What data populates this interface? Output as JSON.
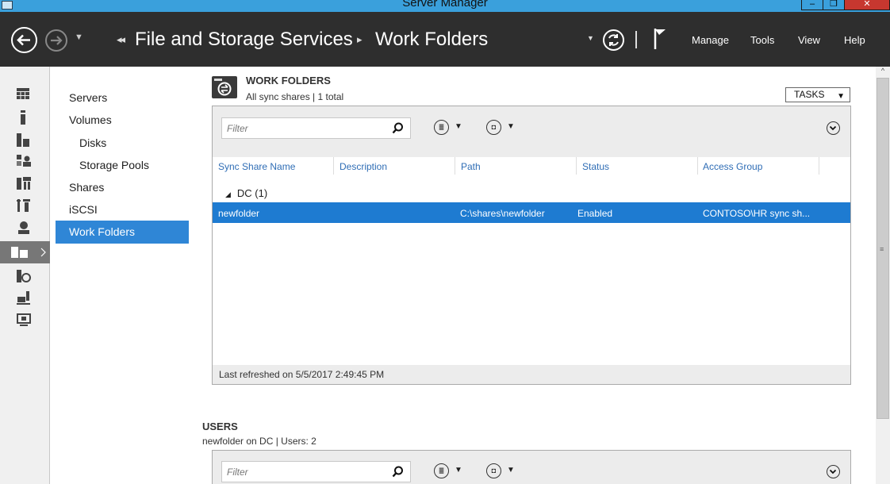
{
  "window": {
    "title": "Server Manager",
    "minimize": "‒",
    "maximize": "❐",
    "close": "✕"
  },
  "navbar": {
    "breadcrumb_prefix": "◂◂",
    "breadcrumb_1": "File and Storage Services",
    "breadcrumb_sep": "▸",
    "breadcrumb_2": "Work Folders",
    "dropdown_caret": "▼",
    "menus": [
      "Manage",
      "Tools",
      "View",
      "Help"
    ]
  },
  "rail_icons": [
    "dashboard-icon",
    "local-server-icon",
    "all-servers-icon",
    "ad-ds-icon",
    "ad-lds-icon",
    "dhcp-icon",
    "dns-icon",
    "file-storage-icon",
    "iis-icon",
    "print-services-icon",
    "remote-desktop-icon"
  ],
  "navpane": {
    "items": [
      "Servers",
      "Volumes",
      "Disks",
      "Storage Pools",
      "Shares",
      "iSCSI",
      "Work Folders"
    ]
  },
  "work_folders": {
    "title": "WORK FOLDERS",
    "subtitle": "All sync shares | 1 total",
    "tasks_label": "TASKS",
    "filter_placeholder": "Filter",
    "columns": [
      "Sync Share Name",
      "Description",
      "Path",
      "Status",
      "Access Group"
    ],
    "group": "DC (1)",
    "rows": [
      {
        "name": "newfolder",
        "description": "",
        "path": "C:\\shares\\newfolder",
        "status": "Enabled",
        "access_group": "CONTOSO\\HR sync sh..."
      }
    ],
    "last_refreshed": "Last refreshed on 5/5/2017 2:49:45 PM"
  },
  "users": {
    "title": "USERS",
    "subtitle": "newfolder on DC | Users: 2",
    "filter_placeholder": "Filter"
  },
  "colors": {
    "titlebar": "#3aa0dc",
    "navbar": "#2e2e2e",
    "selection": "#1e7bd1",
    "nav_selected": "#2f86d6",
    "column_header": "#2f6db5"
  }
}
